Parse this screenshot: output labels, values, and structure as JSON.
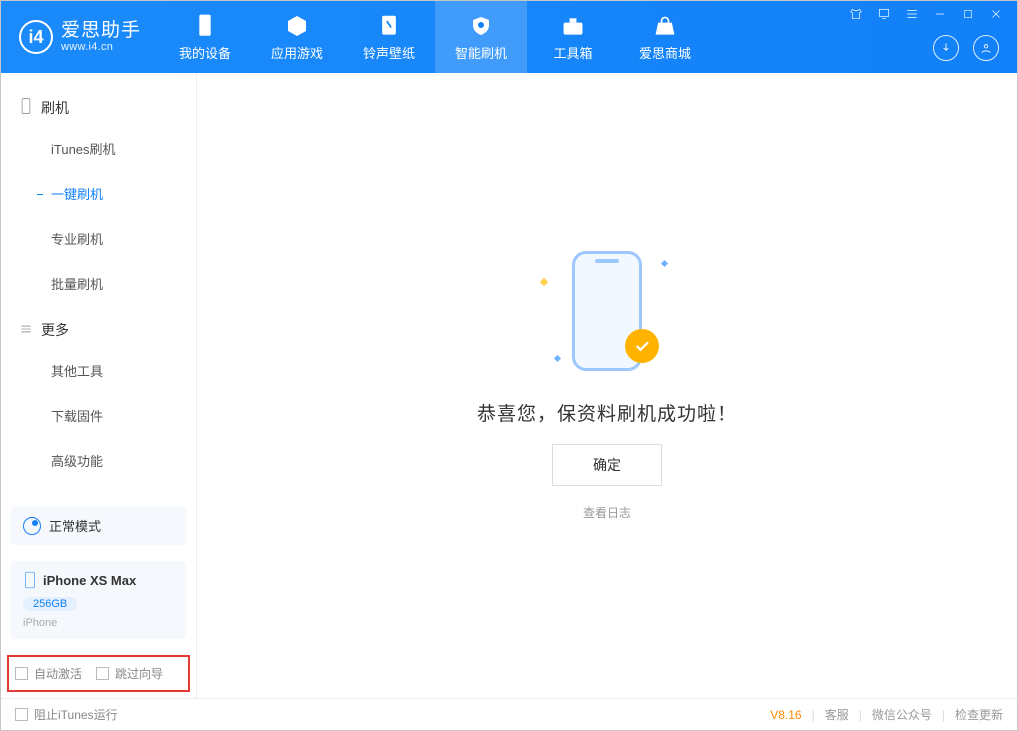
{
  "app": {
    "name_cn": "爱思助手",
    "url": "www.i4.cn"
  },
  "nav": {
    "tabs": [
      {
        "label": "我的设备"
      },
      {
        "label": "应用游戏"
      },
      {
        "label": "铃声壁纸"
      },
      {
        "label": "智能刷机"
      },
      {
        "label": "工具箱"
      },
      {
        "label": "爱思商城"
      }
    ],
    "active_index": 3
  },
  "sidebar": {
    "groups": [
      {
        "title": "刷机",
        "items": [
          "iTunes刷机",
          "一键刷机",
          "专业刷机",
          "批量刷机"
        ],
        "active_index": 1
      },
      {
        "title": "更多",
        "items": [
          "其他工具",
          "下载固件",
          "高级功能"
        ],
        "active_index": -1
      }
    ],
    "mode_label": "正常模式",
    "device": {
      "name": "iPhone XS Max",
      "storage": "256GB",
      "type": "iPhone"
    },
    "bottom_checks": [
      {
        "label": "自动激活",
        "checked": false
      },
      {
        "label": "跳过向导",
        "checked": false
      }
    ]
  },
  "main": {
    "success_text": "恭喜您，保资料刷机成功啦！",
    "confirm_label": "确定",
    "view_log_label": "查看日志"
  },
  "statusbar": {
    "block_itunes_label": "阻止iTunes运行",
    "version": "V8.16",
    "links": [
      "客服",
      "微信公众号",
      "检查更新"
    ]
  }
}
